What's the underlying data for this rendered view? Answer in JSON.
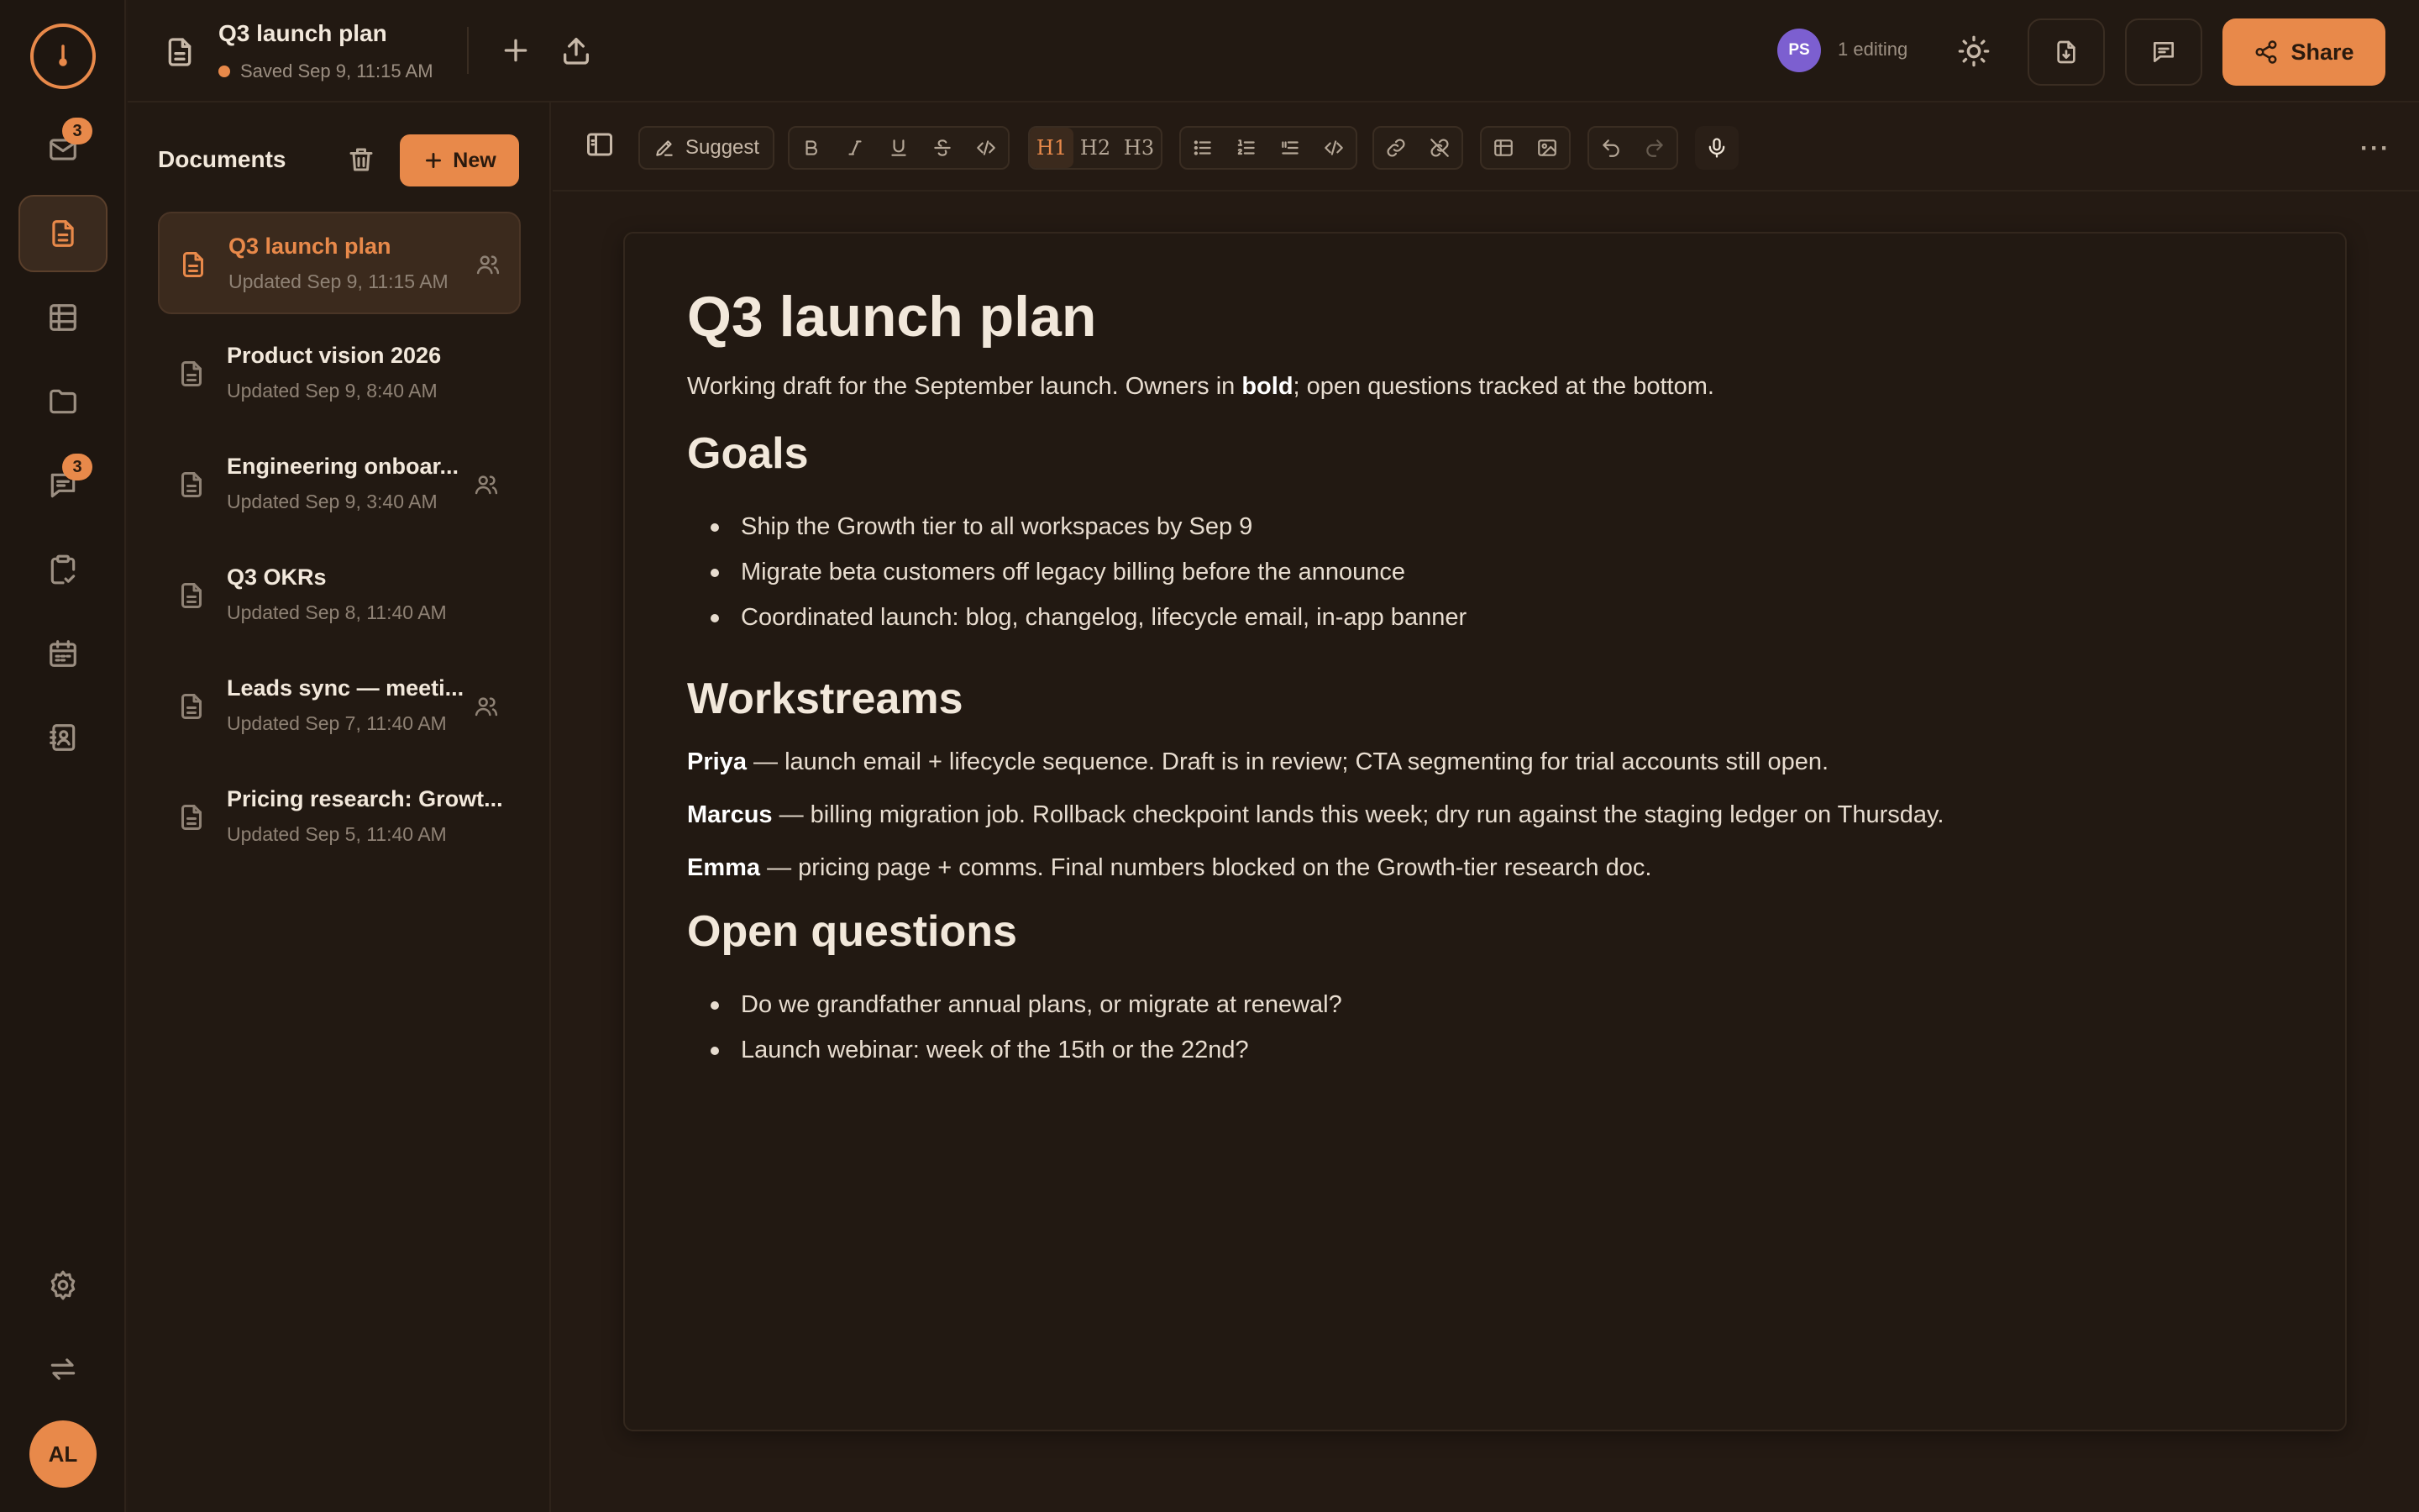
{
  "rail": {
    "mail_badge": "3",
    "chat_badge": "3",
    "user_initials": "AL"
  },
  "topbar": {
    "doc_title": "Q3 launch plan",
    "saved_text": "Saved Sep 9, 11:15 AM",
    "collaborator_initials": "PS",
    "editing_text": "1 editing",
    "share_label": "Share"
  },
  "sidebar": {
    "title": "Documents",
    "new_label": "New",
    "docs": [
      {
        "title": "Q3 launch plan",
        "updated": "Updated Sep 9, 11:15 AM",
        "shared": true,
        "active": true
      },
      {
        "title": "Product vision 2026",
        "updated": "Updated Sep 9, 8:40 AM",
        "shared": false,
        "active": false
      },
      {
        "title": "Engineering onboar...",
        "updated": "Updated Sep 9, 3:40 AM",
        "shared": true,
        "active": false
      },
      {
        "title": "Q3 OKRs",
        "updated": "Updated Sep 8, 11:40 AM",
        "shared": false,
        "active": false
      },
      {
        "title": "Leads sync — meeti...",
        "updated": "Updated Sep 7, 11:40 AM",
        "shared": true,
        "active": false
      },
      {
        "title": "Pricing research: Growt...",
        "updated": "Updated Sep 5, 11:40 AM",
        "shared": false,
        "active": false
      }
    ]
  },
  "toolbar": {
    "suggest_label": "Suggest",
    "h1": "H1",
    "h2": "H2",
    "h3": "H3",
    "more": "···"
  },
  "editor": {
    "title": "Q3 launch plan",
    "intro_pre": "Working draft for the September launch. Owners in ",
    "intro_bold": "bold",
    "intro_post": "; open questions tracked at the bottom.",
    "goals_heading": "Goals",
    "goals": [
      "Ship the Growth tier to all workspaces by Sep 9",
      "Migrate beta customers off legacy billing before the announce",
      "Coordinated launch: blog, changelog, lifecycle email, in-app banner"
    ],
    "workstreams_heading": "Workstreams",
    "workstreams": [
      {
        "owner": "Priya",
        "text": " — launch email + lifecycle sequence. Draft is in review; CTA segmenting for trial accounts still open."
      },
      {
        "owner": "Marcus",
        "text": " — billing migration job. Rollback checkpoint lands this week; dry run against the staging ledger on Thursday."
      },
      {
        "owner": "Emma",
        "text": " — pricing page + comms. Final numbers blocked on the Growth-tier research doc."
      }
    ],
    "questions_heading": "Open questions",
    "questions": [
      "Do we grandfather annual plans, or migrate at renewal?",
      "Launch webinar: week of the 15th or the 22nd?"
    ]
  },
  "colors": {
    "accent": "#e8894a",
    "background": "#241a13",
    "collaborator": "#7c5fd0"
  }
}
